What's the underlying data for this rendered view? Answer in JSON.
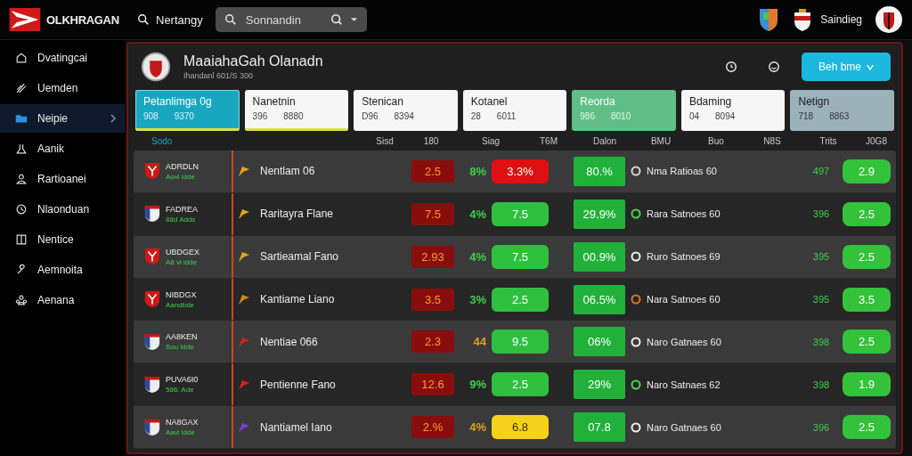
{
  "brand": {
    "name": "OLKHRAGAN"
  },
  "top_search_link": "Nertangy",
  "search": {
    "placeholder": "Sonnandin"
  },
  "user": {
    "name": "Saindieg"
  },
  "sidebar": {
    "items": [
      {
        "label": "Dvatingcai",
        "selected": false
      },
      {
        "label": "Uemden",
        "selected": false
      },
      {
        "label": "Neipie",
        "selected": true
      },
      {
        "label": "Aanik",
        "selected": false
      },
      {
        "label": "Rartioanei",
        "selected": false
      },
      {
        "label": "Nlaonduan",
        "selected": false
      },
      {
        "label": "Nentice",
        "selected": false
      },
      {
        "label": "Aemnoita",
        "selected": false
      },
      {
        "label": "Aenana",
        "selected": false
      }
    ]
  },
  "header": {
    "title": "MaaiahaGah Olanadn",
    "subtitle": "Ihandanl 601/S 300",
    "button": "Beh bme"
  },
  "tabs": [
    {
      "label": "Petanlimga 0g",
      "value_1": "908",
      "value_2": "9370",
      "selected": true,
      "color": "#19a7bf",
      "underline": true
    },
    {
      "label": "Nanetnin",
      "value_1": "396",
      "value_2": "8880",
      "selected": false,
      "color": "#f6f6f6",
      "underline": true
    },
    {
      "label": "Stenican",
      "value_1": "D96",
      "value_2": "8394",
      "selected": false,
      "color": "#f6f6f6",
      "underline": false
    },
    {
      "label": "Kotanel",
      "value_1": "28",
      "value_2": "6011",
      "selected": false,
      "color": "#f6f6f6",
      "underline": false
    },
    {
      "label": "Reorda",
      "value_1": "986",
      "value_2": "8010",
      "selected": false,
      "color": "#5fbf87",
      "underline": false
    },
    {
      "label": "Bdaming",
      "value_1": "04",
      "value_2": "8094",
      "selected": false,
      "color": "#f6f6f6",
      "underline": false
    },
    {
      "label": "Netign",
      "value_1": "718",
      "value_2": "8863",
      "selected": false,
      "color": "#9cb2ba",
      "underline": false
    }
  ],
  "table": {
    "columns": [
      "Sodo",
      "Sisd",
      "180",
      "Siag",
      "T6M",
      "Dalon",
      "BMU",
      "Buo",
      "N8S",
      "Trits",
      "J0G8"
    ],
    "rows": [
      {
        "team": "ADRDLN",
        "team_sub": "Aovi idde",
        "crest": {
          "kind": "red"
        },
        "player": {
          "name": "Nentlam 06",
          "color": "#e8a317"
        },
        "odds_a": "2.5",
        "change": {
          "text": "8%",
          "color": "#3ecf4a"
        },
        "odds_b": {
          "text": "3.3%",
          "color": "#e01010"
        },
        "pct": "80.%",
        "market": {
          "text": "Nma Ratioas 60",
          "color": "#d8d8d8"
        },
        "count": "497",
        "final": "2.9"
      },
      {
        "team": "FADREA",
        "team_sub": "88d Adds",
        "crest": {
          "kind": "tricolor"
        },
        "player": {
          "name": "Raritayra Flane",
          "color": "#e8a317"
        },
        "odds_a": "7.5",
        "change": {
          "text": "4%",
          "color": "#3ecf4a"
        },
        "odds_b": {
          "text": "7.5",
          "color": "#2fbf3f"
        },
        "pct": "29.9%",
        "market": {
          "text": "Rara Satnoes 60",
          "color": "#4fd34a"
        },
        "count": "396",
        "final": "2.5"
      },
      {
        "team": "UBDGEX",
        "team_sub": "A8 vi idde",
        "crest": {
          "kind": "red"
        },
        "player": {
          "name": "Sartieamal Fano",
          "color": "#e8a317"
        },
        "odds_a": "2.93",
        "change": {
          "text": "4%",
          "color": "#3ecf4a"
        },
        "odds_b": {
          "text": "7.5",
          "color": "#2fbf3f"
        },
        "pct": "00.9%",
        "market": {
          "text": "Ruro Satnoes 69",
          "color": "#f0f0f0"
        },
        "count": "395",
        "final": "2.5"
      },
      {
        "team": "NIBDGX",
        "team_sub": "Aandbde",
        "crest": {
          "kind": "red"
        },
        "player": {
          "name": "Kantiame Liano",
          "color": "#c98a20"
        },
        "odds_a": "3.5",
        "change": {
          "text": "3%",
          "color": "#3ecf4a"
        },
        "odds_b": {
          "text": "2.5",
          "color": "#2fbf3f"
        },
        "pct": "06.5%",
        "market": {
          "text": "Nara Satnoes 60",
          "color": "#d9772a"
        },
        "count": "395",
        "final": "3.5"
      },
      {
        "team": "AA8KEN",
        "team_sub": "Sou idde",
        "crest": {
          "kind": "tricolor"
        },
        "player": {
          "name": "Nentiae 066",
          "color": "#d02020"
        },
        "odds_a": "2.3",
        "change": {
          "text": "44",
          "color": "#e0a020"
        },
        "odds_b": {
          "text": "9.5",
          "color": "#2fbf3f"
        },
        "pct": "06%",
        "market": {
          "text": "Naro Gatnaes 60",
          "color": "#f0f0f0"
        },
        "count": "398",
        "final": "2.5"
      },
      {
        "team": "PUVA6I0",
        "team_sub": "586: Ade",
        "crest": {
          "kind": "tricolor"
        },
        "player": {
          "name": "Pentienne Fano",
          "color": "#e02020"
        },
        "odds_a": "12.6",
        "change": {
          "text": "9%",
          "color": "#3ecf4a"
        },
        "odds_b": {
          "text": "2.5",
          "color": "#2fbf3f"
        },
        "pct": "29%",
        "market": {
          "text": "Naro Satnaes 62",
          "color": "#4fd34a"
        },
        "count": "398",
        "final": "1.9"
      },
      {
        "team": "NA8GAX",
        "team_sub": "Aavi idde",
        "crest": {
          "kind": "tricolor"
        },
        "player": {
          "name": "Nantiamel Iano",
          "color": "#7a3fd0"
        },
        "odds_a": "2.%",
        "change": {
          "text": "4%",
          "color": "#e0a020"
        },
        "odds_b": {
          "text": "6.8",
          "color": "#f5d31a"
        },
        "pct": "07.8",
        "market": {
          "text": "Naro Gatnaes 60",
          "color": "#f0f0f0"
        },
        "count": "396",
        "final": "2.5"
      }
    ]
  }
}
